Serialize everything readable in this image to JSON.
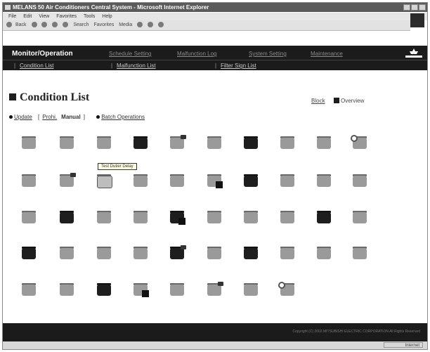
{
  "browser": {
    "title": "MELANS 50 Air Conditioners Central System - Microsoft Internet Explorer",
    "menu": [
      "File",
      "Edit",
      "View",
      "Favorites",
      "Tools",
      "Help"
    ],
    "toolbar": [
      "Back",
      "Search",
      "Favorites",
      "Media"
    ],
    "status_zone": "Internet"
  },
  "nav": {
    "title": "Monitor/Operation",
    "links": [
      {
        "label": "Schedule Setting"
      },
      {
        "label": "Malfunction Log"
      },
      {
        "label": "System Setting"
      },
      {
        "label": "Maintenance"
      }
    ],
    "sublinks": [
      {
        "label": "Condition List"
      },
      {
        "label": "Malfunction List"
      },
      {
        "label": "Filter Sign List"
      }
    ]
  },
  "page": {
    "title": "Condition List",
    "block_label": "Block",
    "overview_label": "Overview",
    "controls": {
      "update": "Update",
      "bracket_open": "[",
      "prohi": "Prohi.",
      "manual": "Manual",
      "bracket_close": "]",
      "batch": "Batch Operations"
    },
    "tooltip": "Test Dutier Delay"
  },
  "grid": {
    "rows": [
      [
        "s",
        "s",
        "s",
        "r",
        "s-b",
        "s",
        "r",
        "s",
        "s",
        "s-c"
      ],
      [
        "s",
        "s-b",
        "s-t",
        "s",
        "s",
        "s-o",
        "r",
        "s",
        "s",
        "s"
      ],
      [
        "s",
        "r",
        "s",
        "s",
        "r-o",
        "s",
        "s",
        "s",
        "r",
        "s"
      ],
      [
        "r",
        "s",
        "s",
        "s",
        "r-b",
        "s",
        "r",
        "s",
        "s",
        "s"
      ],
      [
        "s",
        "s",
        "r",
        "s-o",
        "s",
        "s-b",
        "s",
        "s-c",
        null,
        null
      ]
    ]
  },
  "footer": {
    "copyright": "Copyright (C) 2002 MITSUBISHI ELECTRIC CORPORATION All Rights Reserved"
  }
}
